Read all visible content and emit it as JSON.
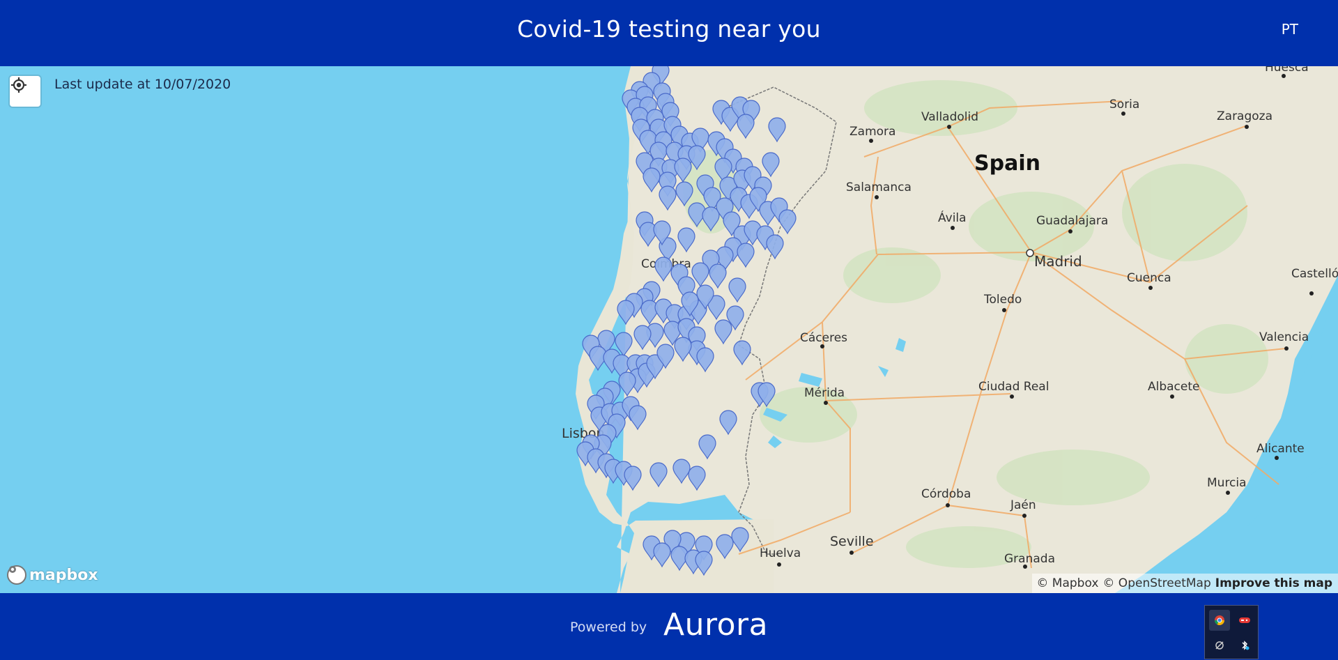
{
  "header": {
    "title": "Covid-19 testing near you",
    "language": "PT"
  },
  "map": {
    "last_update": "Last update at 10/07/2020",
    "country_label": "Spain",
    "cities": [
      "Valladolid",
      "Zamora",
      "Soria",
      "Zaragoza",
      "Huesca",
      "Salamanca",
      "Ávila",
      "Guadalajara",
      "Madrid",
      "Cuenca",
      "Castellón de la Plana",
      "Toledo",
      "Cáceres",
      "Valencia",
      "Mérida",
      "Ciudad Real",
      "Albacete",
      "Alicante",
      "Murcia",
      "Córdoba",
      "Jaén",
      "Seville",
      "Huelva",
      "Granada",
      "Lisbon",
      "Coimbra"
    ],
    "marker_color": "#8fb0ea",
    "water_color": "#75cff0",
    "land_color": "#eae7d9",
    "logo_text": "mapbox",
    "attribution": {
      "mapbox": "© Mapbox",
      "osm": "© OpenStreetMap",
      "improve": "Improve this map"
    }
  },
  "footer": {
    "powered_by": "Powered by",
    "brand": "Aurora"
  },
  "tray": {
    "icons": [
      "chrome-icon",
      "game-controller-icon",
      "network-icon",
      "bluetooth-icon"
    ]
  },
  "colors": {
    "primary": "#0030ac"
  }
}
